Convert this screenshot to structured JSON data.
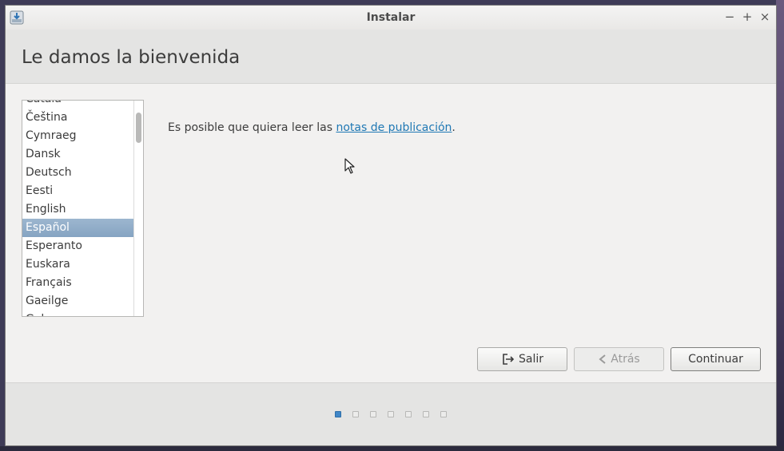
{
  "window": {
    "title": "Instalar",
    "controls": {
      "minimize": "−",
      "maximize": "+",
      "close": "×"
    }
  },
  "header": {
    "title": "Le damos la bienvenida"
  },
  "languages": {
    "items": [
      "Català",
      "Čeština",
      "Cymraeg",
      "Dansk",
      "Deutsch",
      "Eesti",
      "English",
      "Español",
      "Esperanto",
      "Euskara",
      "Français",
      "Gaeilge",
      "Galego"
    ],
    "selected": "Español"
  },
  "release": {
    "prefix": "Es posible que quiera leer las ",
    "link": "notas de publicación",
    "suffix": "."
  },
  "buttons": {
    "quit": "Salir",
    "back": "Atrás",
    "continue": "Continuar"
  },
  "progress": {
    "total_steps": 7,
    "current_step": 1
  },
  "colors": {
    "accent": "#3f86c7",
    "selection": "#86a4c2",
    "link": "#1f78b4"
  }
}
